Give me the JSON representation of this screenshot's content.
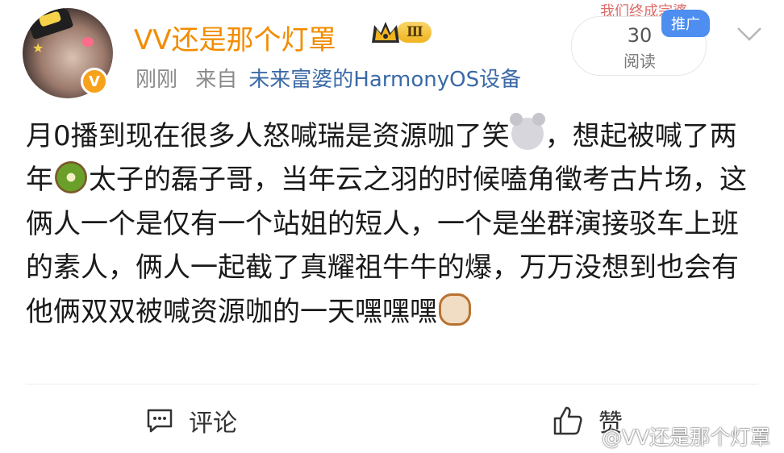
{
  "post": {
    "username": "VV还是那个灯罩",
    "level": "Ⅲ",
    "time": "刚刚",
    "source_prefix": "来自",
    "source": "未来富婆的HarmonyOS设备",
    "read_count": "30",
    "read_label": "阅读",
    "promo_tag": "推广",
    "banner_text": "我们终成宗婆",
    "content": {
      "part1": "月0播到现在很多人怒喊瑞是资源咖了笑",
      "part2": "，想起被喊了两年",
      "part3": "太子的磊子哥，当年云之羽的时候嗑角徵考古片场，这俩人一个是仅有一个站姐的短人，一个是坐群演接驳车上班的素人，俩人一起截了真耀祖牛牛的爆，万万没想到也会有他俩双双被喊资源咖的一天嘿嘿嘿"
    },
    "emojis": [
      "mouse-emoji",
      "kiwi-emoji",
      "cat-emoji"
    ]
  },
  "actions": {
    "comment_label": "评论",
    "like_label": "赞"
  },
  "watermark": "@VV还是那个灯罩",
  "colors": {
    "username": "#f28c00",
    "source_link": "#3b6aa6",
    "promo": "#4d8ef0",
    "vip_badge": "#f7a21b"
  }
}
